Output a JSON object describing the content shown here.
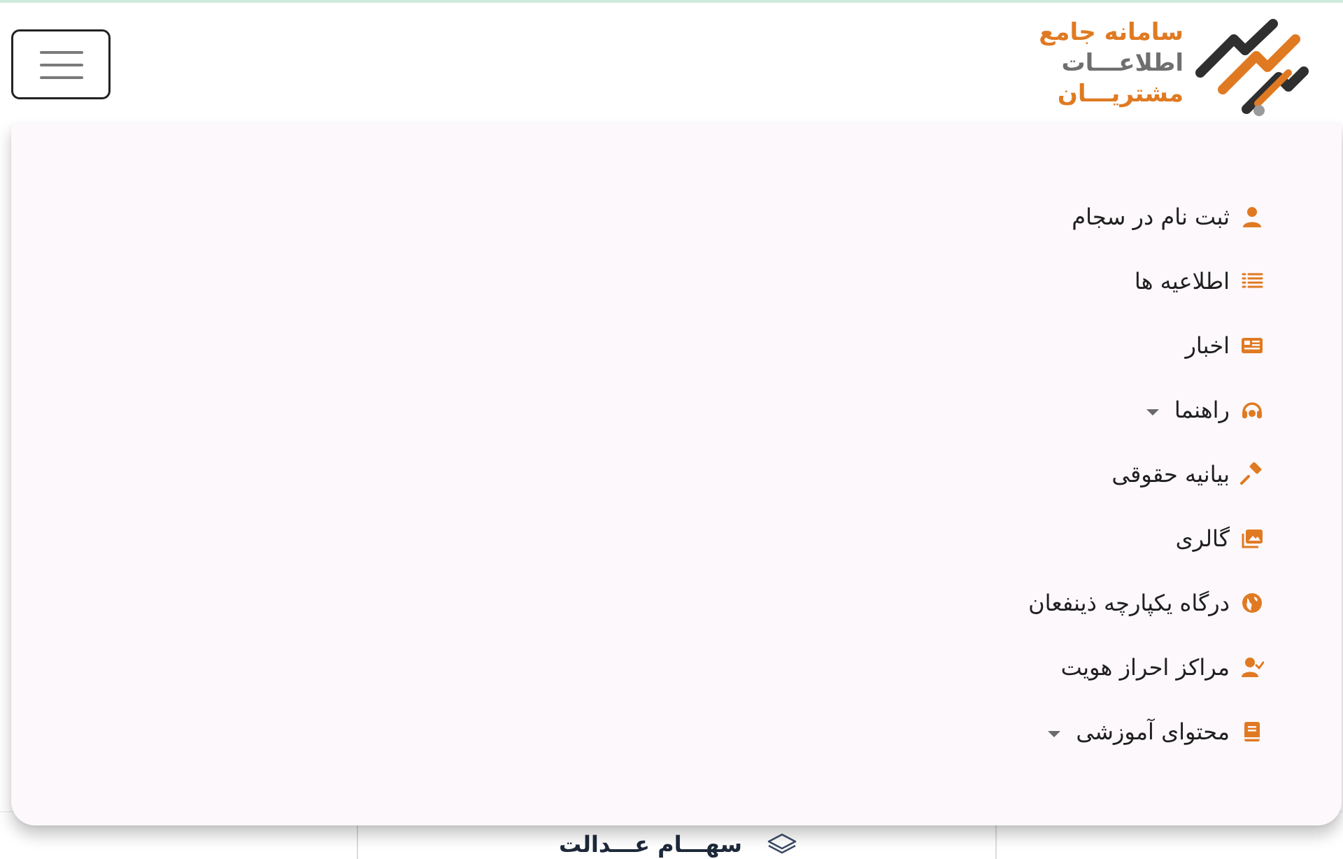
{
  "header": {
    "menu_toggle_label": "",
    "logo": {
      "line1": "سامانه جامع",
      "line2": "اطلاعـــات",
      "line3": "مشتریـــان"
    }
  },
  "colors": {
    "accent": "#e07a22",
    "panel_background": "#fcf8fb",
    "text": "#1f1f1f"
  },
  "menu": {
    "items": [
      {
        "label": "ثبت نام در سجام",
        "icon": "user-icon",
        "has_submenu": false
      },
      {
        "label": "اطلاعیه ها",
        "icon": "list-icon",
        "has_submenu": false
      },
      {
        "label": "اخبار",
        "icon": "newspaper-icon",
        "has_submenu": false
      },
      {
        "label": "راهنما",
        "icon": "headset-icon",
        "has_submenu": true
      },
      {
        "label": "بیانیه حقوقی",
        "icon": "gavel-icon",
        "has_submenu": false
      },
      {
        "label": "گالری",
        "icon": "images-icon",
        "has_submenu": false
      },
      {
        "label": "درگاه یکپارچه ذینفعان",
        "icon": "globe-icon",
        "has_submenu": false
      },
      {
        "label": "مراکز احراز هویت",
        "icon": "user-check-icon",
        "has_submenu": false
      },
      {
        "label": "محتوای آموزشی",
        "icon": "book-icon",
        "has_submenu": true
      }
    ]
  },
  "bottom_tab": {
    "label": "سهـــام عـــدالت",
    "icon": "layers-icon"
  }
}
